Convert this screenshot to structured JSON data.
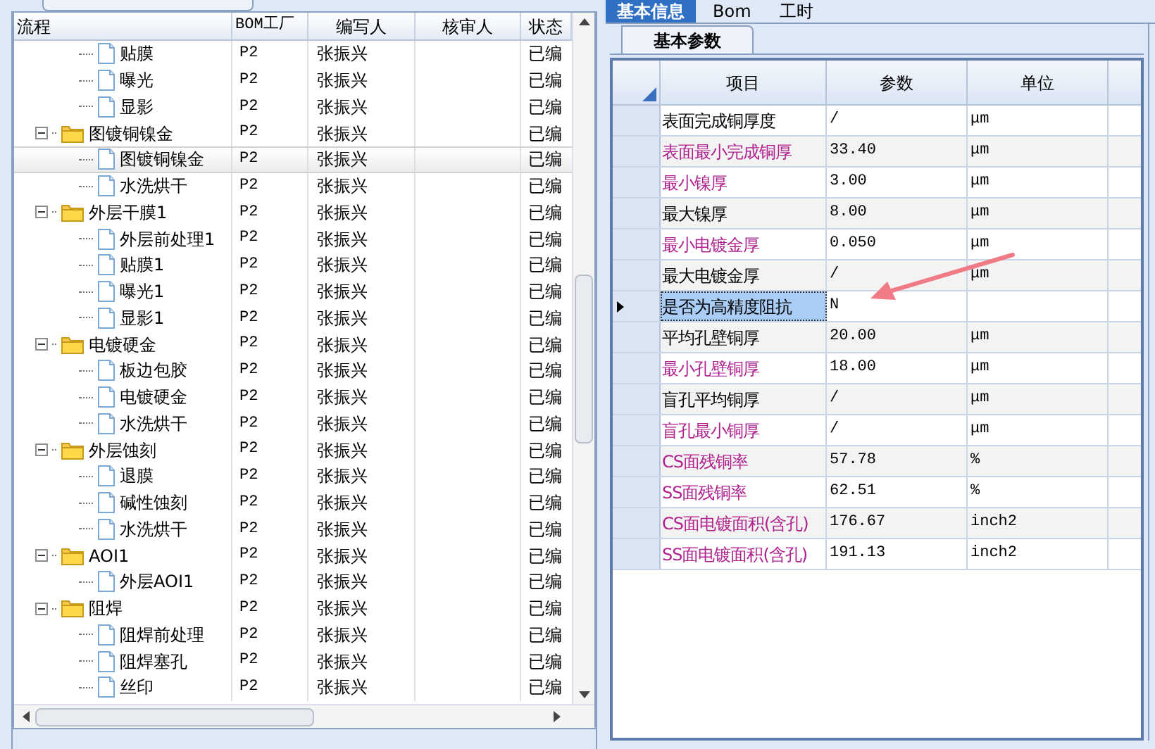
{
  "left_panel": {
    "columns": [
      "流程",
      "BOM工厂",
      "编写人",
      "核审人",
      "状态"
    ],
    "tree": [
      {
        "children": [
          {
            "label": "贴膜",
            "kind": "file",
            "bom": "P2",
            "author": "张振兴",
            "status": "已编",
            "selected": false
          },
          {
            "label": "曝光",
            "kind": "file",
            "bom": "P2",
            "author": "张振兴",
            "status": "已编",
            "selected": false
          },
          {
            "label": "显影",
            "kind": "file",
            "bom": "P2",
            "author": "张振兴",
            "status": "已编",
            "selected": false
          }
        ]
      },
      {
        "label": "图镀铜镍金",
        "kind": "folder",
        "expanded": true,
        "bom": "P2",
        "author": "张振兴",
        "status": "已编",
        "selected": false,
        "children": [
          {
            "label": "图镀铜镍金",
            "kind": "file",
            "bom": "P2",
            "author": "张振兴",
            "status": "已编",
            "selected": true
          },
          {
            "label": "水洗烘干",
            "kind": "file",
            "bom": "P2",
            "author": "张振兴",
            "status": "已编",
            "selected": false
          }
        ]
      },
      {
        "label": "外层干膜1",
        "kind": "folder",
        "expanded": true,
        "bom": "P2",
        "author": "张振兴",
        "status": "已编",
        "selected": false,
        "children": [
          {
            "label": "外层前处理1",
            "kind": "file",
            "bom": "P2",
            "author": "张振兴",
            "status": "已编",
            "selected": false
          },
          {
            "label": "贴膜1",
            "kind": "file",
            "bom": "P2",
            "author": "张振兴",
            "status": "已编",
            "selected": false
          },
          {
            "label": "曝光1",
            "kind": "file",
            "bom": "P2",
            "author": "张振兴",
            "status": "已编",
            "selected": false
          },
          {
            "label": "显影1",
            "kind": "file",
            "bom": "P2",
            "author": "张振兴",
            "status": "已编",
            "selected": false
          }
        ]
      },
      {
        "label": "电镀硬金",
        "kind": "folder",
        "expanded": true,
        "bom": "P2",
        "author": "张振兴",
        "status": "已编",
        "selected": false,
        "children": [
          {
            "label": "板边包胶",
            "kind": "file",
            "bom": "P2",
            "author": "张振兴",
            "status": "已编",
            "selected": false
          },
          {
            "label": "电镀硬金",
            "kind": "file",
            "bom": "P2",
            "author": "张振兴",
            "status": "已编",
            "selected": false
          },
          {
            "label": "水洗烘干",
            "kind": "file",
            "bom": "P2",
            "author": "张振兴",
            "status": "已编",
            "selected": false
          }
        ]
      },
      {
        "label": "外层蚀刻",
        "kind": "folder",
        "expanded": true,
        "bom": "P2",
        "author": "张振兴",
        "status": "已编",
        "selected": false,
        "children": [
          {
            "label": "退膜",
            "kind": "file",
            "bom": "P2",
            "author": "张振兴",
            "status": "已编",
            "selected": false
          },
          {
            "label": "碱性蚀刻",
            "kind": "file",
            "bom": "P2",
            "author": "张振兴",
            "status": "已编",
            "selected": false
          },
          {
            "label": "水洗烘干",
            "kind": "file",
            "bom": "P2",
            "author": "张振兴",
            "status": "已编",
            "selected": false
          }
        ]
      },
      {
        "label": "AOI1",
        "kind": "folder",
        "expanded": true,
        "bom": "P2",
        "author": "张振兴",
        "status": "已编",
        "selected": false,
        "children": [
          {
            "label": "外层AOI1",
            "kind": "file",
            "bom": "P2",
            "author": "张振兴",
            "status": "已编",
            "selected": false
          }
        ]
      },
      {
        "label": "阻焊",
        "kind": "folder",
        "expanded": true,
        "bom": "P2",
        "author": "张振兴",
        "status": "已编",
        "selected": false,
        "children": [
          {
            "label": "阻焊前处理",
            "kind": "file",
            "bom": "P2",
            "author": "张振兴",
            "status": "已编",
            "selected": false
          },
          {
            "label": "阻焊塞孔",
            "kind": "file",
            "bom": "P2",
            "author": "张振兴",
            "status": "已编",
            "selected": false
          },
          {
            "label": "丝印",
            "kind": "file",
            "bom": "P2",
            "author": "张振兴",
            "status": "已编",
            "selected": false
          }
        ]
      }
    ]
  },
  "right_panel": {
    "tabs": [
      {
        "label": "基本信息",
        "selected": true
      },
      {
        "label": "Bom",
        "selected": false
      },
      {
        "label": "工时",
        "selected": false
      }
    ],
    "sub_tabs": [
      {
        "label": "基本参数",
        "selected": true
      }
    ],
    "columns": [
      "项目",
      "参数",
      "单位"
    ],
    "rows": [
      {
        "item": "表面完成铜厚度",
        "value": "/",
        "unit": "μm",
        "highlight": false,
        "selected": false
      },
      {
        "item": "表面最小完成铜厚",
        "value": "33.40",
        "unit": "μm",
        "highlight": true,
        "selected": false
      },
      {
        "item": "最小镍厚",
        "value": "3.00",
        "unit": "μm",
        "highlight": true,
        "selected": false
      },
      {
        "item": "最大镍厚",
        "value": "8.00",
        "unit": "μm",
        "highlight": false,
        "selected": false
      },
      {
        "item": "最小电镀金厚",
        "value": "0.050",
        "unit": "μm",
        "highlight": true,
        "selected": false
      },
      {
        "item": "最大电镀金厚",
        "value": "/",
        "unit": "μm",
        "highlight": false,
        "selected": false
      },
      {
        "item": "是否为高精度阻抗",
        "value": "N",
        "highlight": false,
        "selected": true
      },
      {
        "item": "平均孔壁铜厚",
        "value": "20.00",
        "unit": "μm",
        "highlight": false,
        "selected": false
      },
      {
        "item": "最小孔壁铜厚",
        "value": "18.00",
        "unit": "μm",
        "highlight": true,
        "selected": false
      },
      {
        "item": "盲孔平均铜厚",
        "value": "/",
        "unit": "μm",
        "highlight": false,
        "selected": false
      },
      {
        "item": "盲孔最小铜厚",
        "value": "/",
        "unit": "μm",
        "highlight": true,
        "selected": false
      },
      {
        "item": "CS面残铜率",
        "value": "57.78",
        "unit": "%",
        "highlight": true,
        "selected": false
      },
      {
        "item": "SS面残铜率",
        "value": "62.51",
        "unit": "%",
        "highlight": true,
        "selected": false
      },
      {
        "item": "CS面电镀面积(含孔)",
        "value": "176.67",
        "unit": "inch2",
        "highlight": true,
        "selected": false
      },
      {
        "item": "SS面电镀面积(含孔)",
        "value": "191.13",
        "unit": "inch2",
        "highlight": true,
        "selected": false
      }
    ]
  }
}
